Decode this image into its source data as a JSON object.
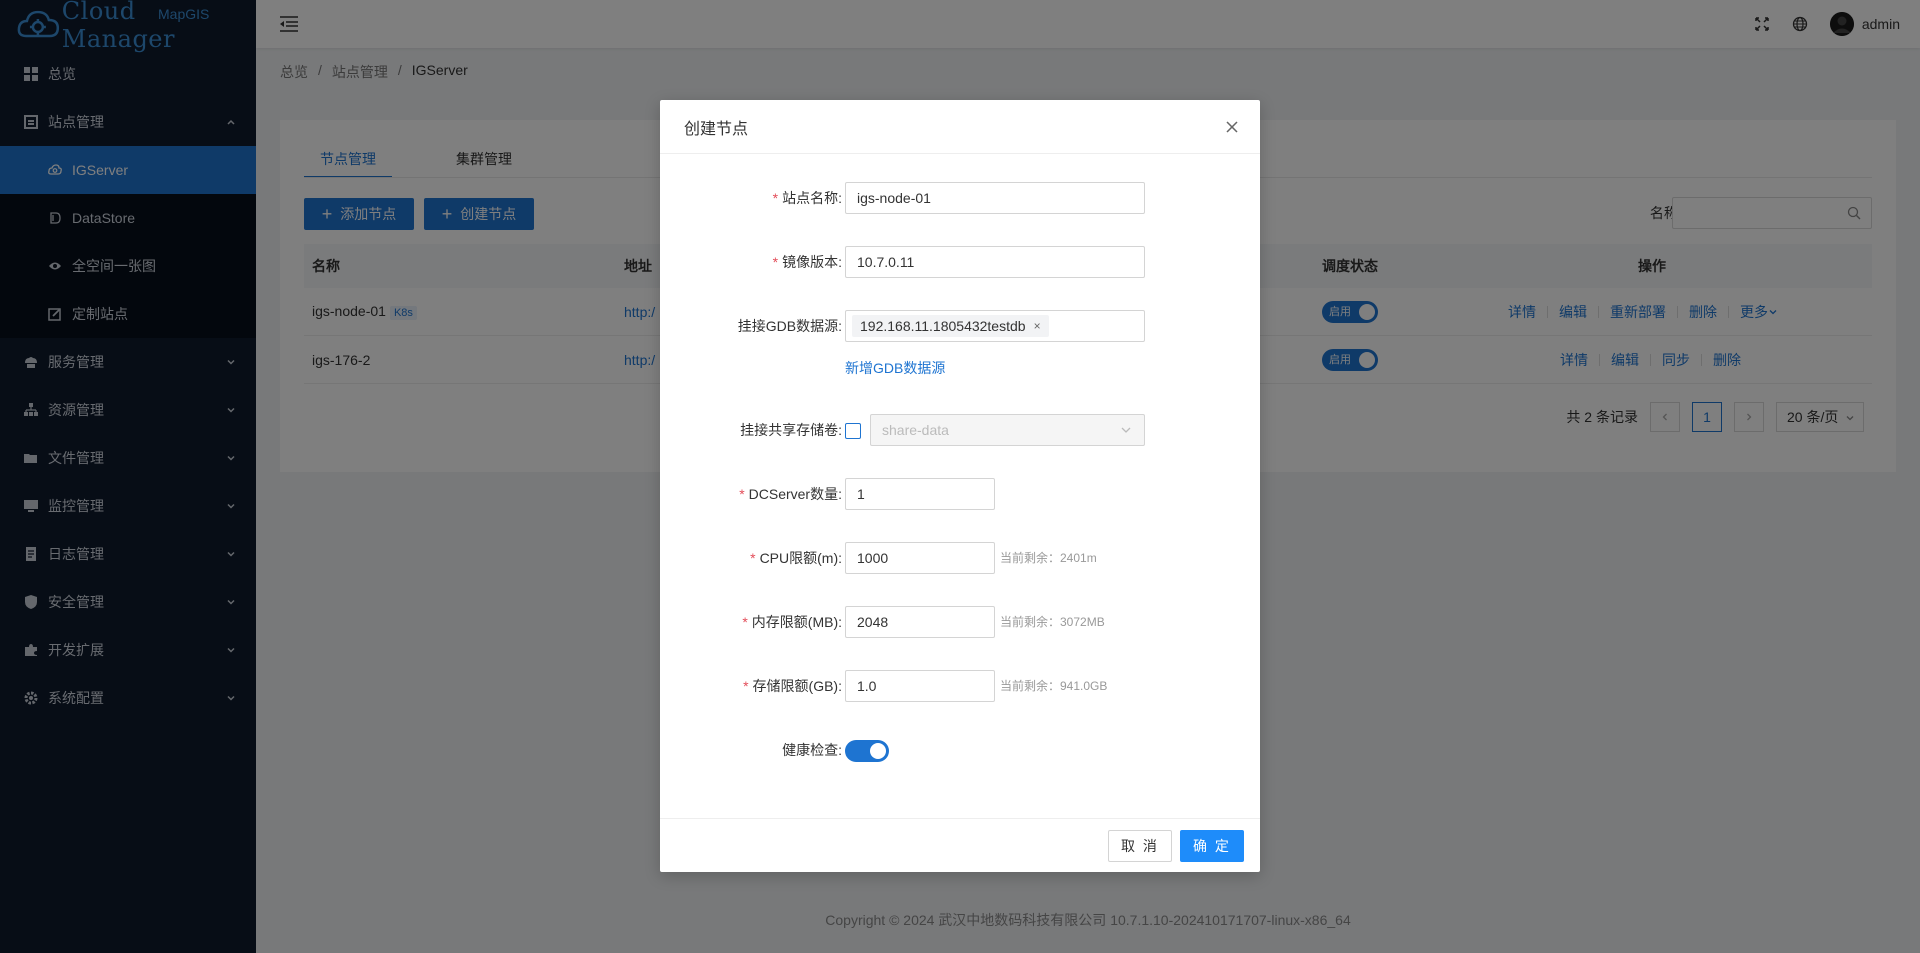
{
  "app": {
    "logo_text": "Cloud Manager",
    "logo_sup": "MapGIS"
  },
  "colors": {
    "primary": "#1e74d1",
    "sidebar_bg": "#0f1b2d",
    "submenu_bg": "#070e1a",
    "required": "#e34d59"
  },
  "sidebar": {
    "items": [
      {
        "label": "总览",
        "icon": "dashboard-icon"
      },
      {
        "label": "站点管理",
        "icon": "site-icon",
        "expanded": true,
        "children": [
          {
            "label": "IGServer",
            "icon": "cloud-icon",
            "active": true
          },
          {
            "label": "DataStore",
            "icon": "datastore-icon"
          },
          {
            "label": "全空间一张图",
            "icon": "eye-icon"
          },
          {
            "label": "定制站点",
            "icon": "edit-icon"
          }
        ]
      },
      {
        "label": "服务管理",
        "icon": "service-icon"
      },
      {
        "label": "资源管理",
        "icon": "resource-icon"
      },
      {
        "label": "文件管理",
        "icon": "folder-icon"
      },
      {
        "label": "监控管理",
        "icon": "monitor-icon"
      },
      {
        "label": "日志管理",
        "icon": "log-icon"
      },
      {
        "label": "安全管理",
        "icon": "shield-icon"
      },
      {
        "label": "开发扩展",
        "icon": "puzzle-icon"
      },
      {
        "label": "系统配置",
        "icon": "gear-icon"
      }
    ]
  },
  "header": {
    "user": "admin"
  },
  "breadcrumb": [
    "总览",
    "站点管理",
    "IGServer"
  ],
  "main": {
    "tabs": [
      {
        "label": "节点管理",
        "active": true
      },
      {
        "label": "集群管理",
        "active": false
      }
    ],
    "add_node_label": "添加节点",
    "create_node_label": "创建节点",
    "search_label": "名称或IP:",
    "columns": {
      "name": "名称",
      "address": "地址",
      "schedule": "调度状态",
      "ops": "操作"
    },
    "rows": [
      {
        "name": "igs-node-01",
        "tag": "K8s",
        "address": "http:/",
        "schedule": "启用",
        "ops": [
          "详情",
          "编辑",
          "重新部署",
          "删除",
          "更多"
        ]
      },
      {
        "name": "igs-176-2",
        "tag": "",
        "address": "http:/",
        "schedule": "启用",
        "ops": [
          "详情",
          "编辑",
          "同步",
          "删除"
        ]
      }
    ],
    "pager": {
      "total": "共 2 条记录",
      "current": "1",
      "size": "20 条/页"
    }
  },
  "footer": "Copyright © 2024 武汉中地数码科技有限公司 10.7.1.10-202410171707-linux-x86_64",
  "modal": {
    "title": "创建节点",
    "fields": {
      "site_name": {
        "label": "站点名称:",
        "value": "igs-node-01"
      },
      "image_version": {
        "label": "镜像版本:",
        "value": "10.7.0.11"
      },
      "gdb": {
        "label": "挂接GDB数据源:",
        "tag": "192.168.11.1805432testdb",
        "add_link": "新增GDB数据源"
      },
      "share": {
        "label": "挂接共享存储卷:",
        "placeholder": "share-data"
      },
      "dcserver": {
        "label": "DCServer数量:",
        "value": "1"
      },
      "cpu": {
        "label": "CPU限额(m):",
        "value": "1000",
        "hint": "当前剩余：2401m"
      },
      "memory": {
        "label": "内存限额(MB):",
        "value": "2048",
        "hint": "当前剩余：3072MB"
      },
      "storage": {
        "label": "存储限额(GB):",
        "value": "1.0",
        "hint": "当前剩余：941.0GB"
      },
      "health": {
        "label": "健康检查:"
      }
    },
    "cancel_label": "取 消",
    "ok_label": "确 定"
  }
}
